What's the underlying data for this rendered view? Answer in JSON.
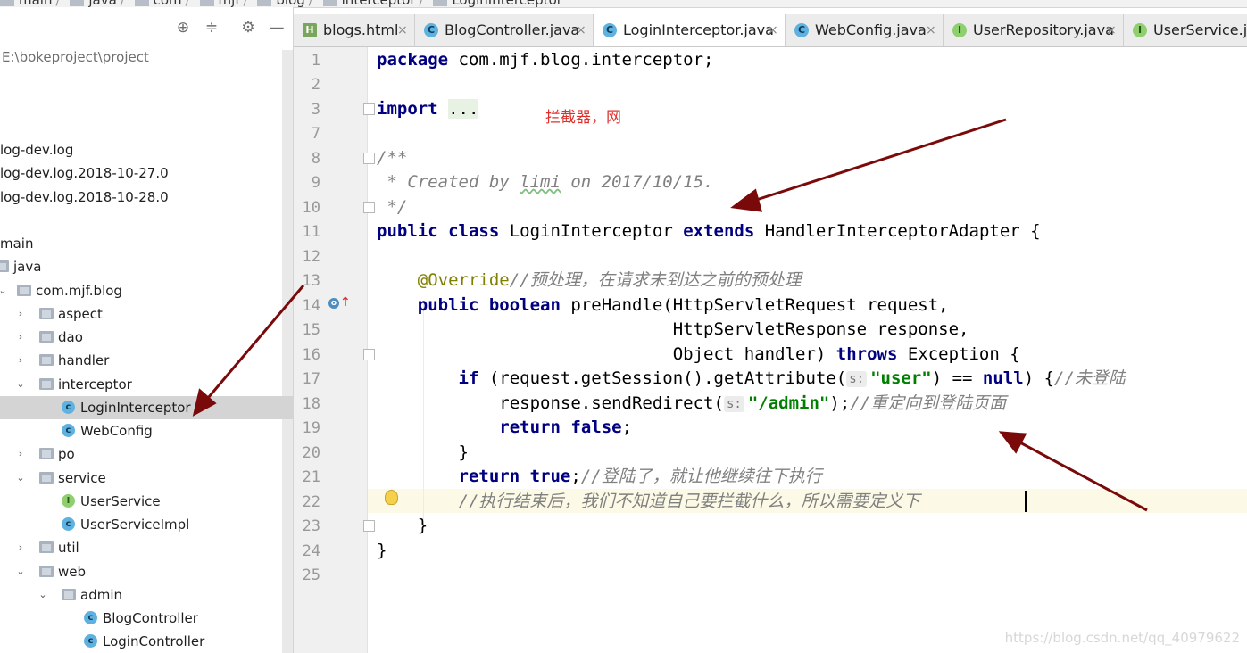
{
  "breadcrumb": [
    "main",
    "java",
    "com",
    "mjf",
    "blog",
    "interceptor",
    "LoginInterceptor"
  ],
  "project_panel": {
    "root_path": "E:\\bokeproject\\project",
    "toolbar_icons": [
      "crosshair-icon",
      "collapse-icon",
      "gear-icon",
      "minimize-icon"
    ],
    "tree": [
      {
        "label": "log-dev.log"
      },
      {
        "label": "log-dev.log.2018-10-27.0"
      },
      {
        "label": "log-dev.log.2018-10-28.0"
      },
      {
        "label": "main"
      },
      {
        "label": "java"
      },
      {
        "label": "com.mjf.blog"
      },
      {
        "label": "aspect"
      },
      {
        "label": "dao"
      },
      {
        "label": "handler"
      },
      {
        "label": "interceptor"
      },
      {
        "label": "LoginInterceptor"
      },
      {
        "label": "WebConfig"
      },
      {
        "label": "po"
      },
      {
        "label": "service"
      },
      {
        "label": "UserService"
      },
      {
        "label": "UserServiceImpl"
      },
      {
        "label": "util"
      },
      {
        "label": "web"
      },
      {
        "label": "admin"
      },
      {
        "label": "BlogController"
      },
      {
        "label": "LoginController"
      }
    ]
  },
  "tabs": [
    {
      "label": "blogs.html",
      "icon": "H",
      "close": "×"
    },
    {
      "label": "BlogController.java",
      "icon": "C",
      "close": "×"
    },
    {
      "label": "LoginInterceptor.java",
      "icon": "C",
      "close": "×"
    },
    {
      "label": "WebConfig.java",
      "icon": "C",
      "close": "×"
    },
    {
      "label": "UserRepository.java",
      "icon": "I",
      "close": "×"
    },
    {
      "label": "UserService.java",
      "icon": "I",
      "close": "×"
    }
  ],
  "editor": {
    "line_numbers": [
      "1",
      "2",
      "3",
      "7",
      "8",
      "9",
      "10",
      "11",
      "12",
      "13",
      "14",
      "15",
      "16",
      "17",
      "18",
      "19",
      "20",
      "21",
      "22",
      "23",
      "24",
      "25"
    ],
    "red_note": "拦截器，网",
    "code": {
      "l1_kw": "package",
      "l1_rest": " com.mjf.blog.interceptor;",
      "l3_kw": "import",
      "l3_rest": "...",
      "l8": "/**",
      "l9a": " * Created by ",
      "l9b": "limi",
      "l9c": " on 2017/10/15.",
      "l10": " */",
      "l11_kw1": "public",
      "l11_kw2": "class",
      "l11_name": " LoginInterceptor ",
      "l11_kw3": "extends",
      "l11_rest": " HandlerInterceptorAdapter {",
      "l13_ann": "@Override",
      "l13_cm": "//预处理，在请求未到达之前的预处理",
      "l14_kw1": "public",
      "l14_kw2": "boolean",
      "l14_rest": " preHandle(HttpServletRequest request,",
      "l15": "HttpServletResponse response,",
      "l16_a": "Object handler) ",
      "l16_kw": "throws",
      "l16_b": " Exception {",
      "l17_kw": "if",
      "l17_a": " (request.getSession().getAttribute(",
      "l17_hint": "s:",
      "l17_str": "\"user\"",
      "l17_b": ") == ",
      "l17_null": "null",
      "l17_c": ") {",
      "l17_cm": "//未登陆",
      "l18_a": "response.sendRedirect(",
      "l18_hint": "s:",
      "l18_str": "\"/admin\"",
      "l18_b": ");",
      "l18_cm": "//重定向到登陆页面",
      "l19_kw": "return",
      "l19_kw2": "false",
      "l19_b": ";",
      "l20": "}",
      "l21_kw": "return",
      "l21_kw2": "true",
      "l21_b": ";",
      "l21_cm": "//登陆了，就让他继续往下执行",
      "l22_cm": "//执行结束后，我们不知道自己要拦截什么，所以需要定义下",
      "l23": "}",
      "l24": "}"
    }
  },
  "watermark": "https://blog.csdn.net/qq_40979622",
  "colors": {
    "keyword": "#000080",
    "comment": "#808080",
    "string": "#008000",
    "annotation": "#808000",
    "arrow": "#7a0a0a",
    "note": "#e0302b"
  }
}
